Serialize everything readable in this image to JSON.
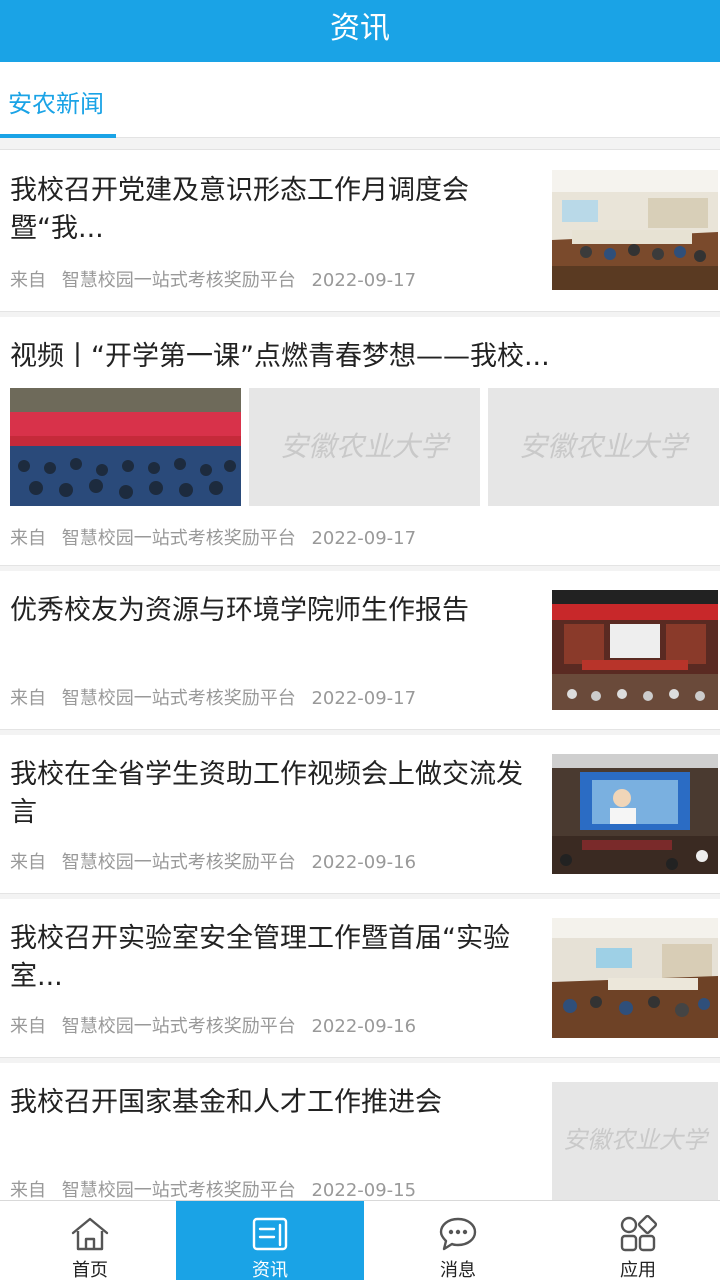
{
  "header": {
    "title": "资讯"
  },
  "tabs": [
    {
      "label": "安农新闻"
    }
  ],
  "news": [
    {
      "title": "我校召开党建及意识形态工作月调度会暨“我...",
      "source": "来自",
      "platform": "智慧校园一站式考核奖励平台",
      "date": "2022-09-17"
    },
    {
      "title": "视频丨“开学第一课”点燃青春梦想——我校...",
      "source": "来自",
      "platform": "智慧校园一站式考核奖励平台",
      "date": "2022-09-17"
    },
    {
      "title": "优秀校友为资源与环境学院师生作报告",
      "source": "来自",
      "platform": "智慧校园一站式考核奖励平台",
      "date": "2022-09-17"
    },
    {
      "title": "我校在全省学生资助工作视频会上做交流发言",
      "source": "来自",
      "platform": "智慧校园一站式考核奖励平台",
      "date": "2022-09-16"
    },
    {
      "title": "我校召开实验室安全管理工作暨首届“实验室...",
      "source": "来自",
      "platform": "智慧校园一站式考核奖励平台",
      "date": "2022-09-16"
    },
    {
      "title": "我校召开国家基金和人才工作推进会",
      "source": "来自",
      "platform": "智慧校园一站式考核奖励平台",
      "date": "2022-09-15"
    }
  ],
  "placeholder_logo_text": "安徽农业大学",
  "nav": [
    {
      "label": "首页",
      "icon": "home-icon"
    },
    {
      "label": "资讯",
      "icon": "news-icon",
      "active": true
    },
    {
      "label": "消息",
      "icon": "chat-icon"
    },
    {
      "label": "应用",
      "icon": "apps-icon"
    }
  ],
  "colors": {
    "accent": "#1aa3e6",
    "meta": "#999999",
    "divider": "#e4e4e4"
  }
}
